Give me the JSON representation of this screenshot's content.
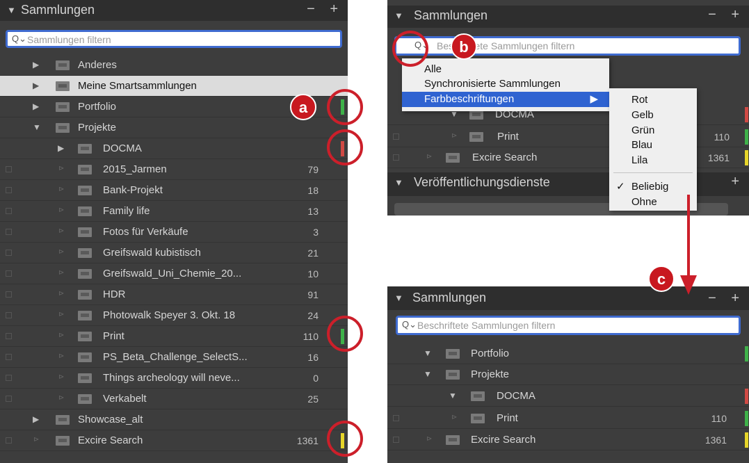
{
  "left": {
    "header": "Sammlungen",
    "pm": "− +",
    "search_placeholder": "Sammlungen filtern",
    "rows": [
      {
        "label": "Anderes",
        "count": ""
      },
      {
        "label": "Meine Smartsammlungen",
        "count": ""
      },
      {
        "label": "Portfolio",
        "count": ""
      },
      {
        "label": "Projekte",
        "count": ""
      },
      {
        "label": "DOCMA",
        "count": ""
      },
      {
        "label": "2015_Jarmen",
        "count": "79"
      },
      {
        "label": "Bank-Projekt",
        "count": "18"
      },
      {
        "label": "Family life",
        "count": "13"
      },
      {
        "label": "Fotos für Verkäufe",
        "count": "3"
      },
      {
        "label": "Greifswald kubistisch",
        "count": "21"
      },
      {
        "label": "Greifswald_Uni_Chemie_20...",
        "count": "10"
      },
      {
        "label": "HDR",
        "count": "91"
      },
      {
        "label": "Photowalk Speyer 3. Okt. 18",
        "count": "24"
      },
      {
        "label": "Print",
        "count": "110"
      },
      {
        "label": "PS_Beta_Challenge_SelectS...",
        "count": "16"
      },
      {
        "label": "Things archeology will neve...",
        "count": "0"
      },
      {
        "label": "Verkabelt",
        "count": "25"
      },
      {
        "label": "Showcase_alt",
        "count": ""
      },
      {
        "label": "Excire Search",
        "count": "1361"
      }
    ]
  },
  "top_right": {
    "header": "Sammlungen",
    "pm": "− +",
    "search_placeholder": "Beschriftete Sammlungen filtern",
    "rows": [
      {
        "label": "DOCMA",
        "count": ""
      },
      {
        "label": "Print",
        "count": "110"
      },
      {
        "label": "Excire Search",
        "count": "1361"
      }
    ],
    "services_header": "Veröffentlichungsdienste",
    "services_plus": "+"
  },
  "menu": {
    "items": [
      "Alle",
      "Synchronisierte Sammlungen",
      "Farbbeschriftungen"
    ],
    "submenu_arrow": "▶",
    "sub_items": [
      "Rot",
      "Gelb",
      "Grün",
      "Blau",
      "Lila"
    ],
    "sub_check": "✓",
    "sub_items2": [
      "Beliebig",
      "Ohne"
    ]
  },
  "bottom_right": {
    "header": "Sammlungen",
    "pm": "− +",
    "search_placeholder": "Beschriftete Sammlungen filtern",
    "rows": [
      {
        "label": "Portfolio",
        "count": ""
      },
      {
        "label": "Projekte",
        "count": ""
      },
      {
        "label": "DOCMA",
        "count": ""
      },
      {
        "label": "Print",
        "count": "110"
      },
      {
        "label": "Excire Search",
        "count": "1361"
      }
    ]
  },
  "badges": {
    "a": "a",
    "b": "b",
    "c": "c"
  },
  "colors": {
    "green": "#3fb24a",
    "red": "#d04a45",
    "yellow": "#e6d52a",
    "accent": "#3f6bd0",
    "annotation": "#cc1f2a"
  },
  "icons": {
    "search": "search-icon",
    "folder": "collection-set-icon",
    "collection": "collection-icon",
    "disclosure": "disclosure-triangle-icon"
  }
}
